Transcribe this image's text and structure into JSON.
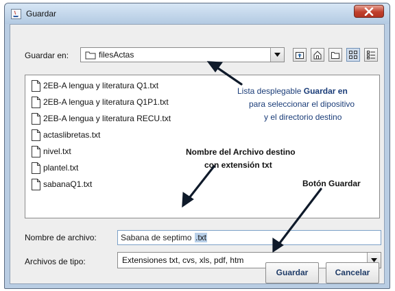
{
  "window": {
    "title": "Guardar"
  },
  "save_in": {
    "label": "Guardar en:",
    "value": "filesActas"
  },
  "toolbar": {
    "icons": [
      "up-folder-icon",
      "home-icon",
      "new-folder-icon",
      "list-view-icon",
      "details-view-icon"
    ],
    "selected": "list-view-icon"
  },
  "files": [
    "2EB-A lengua y literatura Q1.txt",
    "2EB-A lengua y literatura Q1P1.txt",
    "2EB-A lengua y literatura RECU.txt",
    "actaslibretas.txt",
    "nivel.txt",
    "plantel.txt",
    "sabanaQ1.txt"
  ],
  "filename": {
    "label": "Nombre de archivo:",
    "value_plain": "Sabana de septimo",
    "value_selected": ".txt"
  },
  "filetype": {
    "label": "Archivos de tipo:",
    "value": "Extensiones txt, cvs, xls, pdf, htm"
  },
  "buttons": {
    "save": "Guardar",
    "cancel": "Cancelar"
  },
  "annotations": {
    "combo_note": {
      "line1_prefix": "Lista desplegable ",
      "line1_bold": "Guardar en",
      "line2": "para seleccionar el dipositivo",
      "line3": "y el directorio destino"
    },
    "filename_note": {
      "line1": "Nombre del Archivo destino",
      "line2": "con extensión txt"
    },
    "button_note": "Botón Guardar"
  },
  "colors": {
    "annotation_text": "#1a3c78",
    "arrow": "#0f1a2a",
    "selection": "#b8cfe8"
  }
}
